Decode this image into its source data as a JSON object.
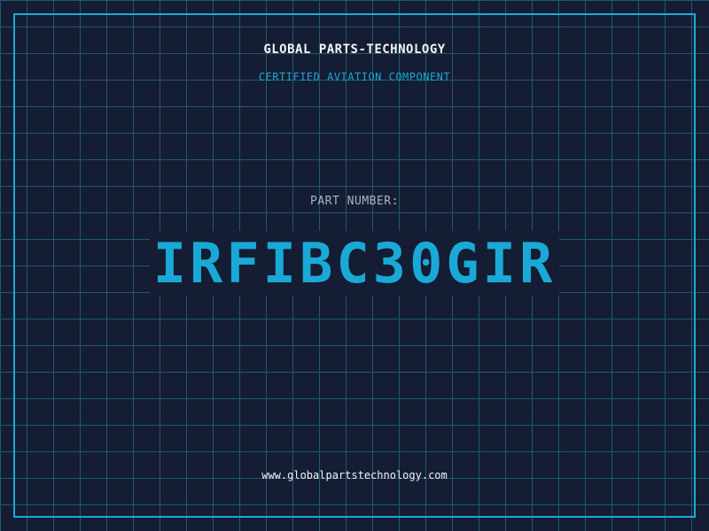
{
  "brand": {
    "name": "GLOBAL PARTS-TECHNOLOGY",
    "tagline": "CERTIFIED AVIATION COMPONENT"
  },
  "part": {
    "label": "PART NUMBER:",
    "number": "IRFIBC30GIR"
  },
  "footer": {
    "website": "www.globalpartstechnology.com"
  },
  "colors": {
    "background": "#141d33",
    "grid": "#1f5a6c",
    "accent": "#1aa9d6",
    "text": "#f2f4f8",
    "muted": "#a9b4c6"
  }
}
